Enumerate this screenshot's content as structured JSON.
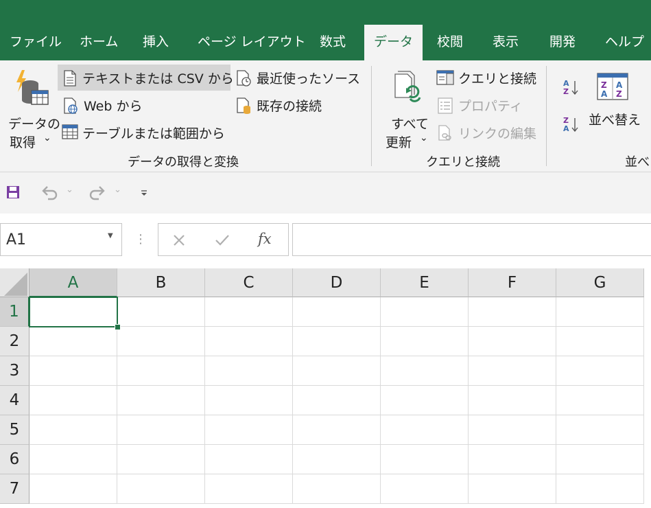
{
  "tabs": [
    {
      "label": "ファイル",
      "active": false
    },
    {
      "label": "ホーム",
      "active": false
    },
    {
      "label": "挿入",
      "active": false
    },
    {
      "label": "ページ レイアウト",
      "active": false
    },
    {
      "label": "数式",
      "active": false
    },
    {
      "label": "データ",
      "active": true
    },
    {
      "label": "校閲",
      "active": false
    },
    {
      "label": "表示",
      "active": false
    },
    {
      "label": "開発",
      "active": false
    },
    {
      "label": "ヘルプ",
      "active": false
    }
  ],
  "ribbon": {
    "get_data": {
      "button_line1": "データの",
      "button_line2": "取得",
      "from_text_csv": "テキストまたは CSV から",
      "from_web": "Web から",
      "from_table": "テーブルまたは範囲から",
      "recent_sources": "最近使ったソース",
      "existing_connections": "既存の接続",
      "group_label": "データの取得と変換"
    },
    "queries": {
      "refresh_line1": "すべて",
      "refresh_line2": "更新",
      "queries_connections": "クエリと接続",
      "properties": "プロパティ",
      "edit_links": "リンクの編集",
      "group_label": "クエリと接続"
    },
    "sort": {
      "sort_label": "並べ替え",
      "group_label": "並べ"
    }
  },
  "formula_bar": {
    "name_box": "A1",
    "fx_label": "fx",
    "formula": ""
  },
  "grid": {
    "columns": [
      "A",
      "B",
      "C",
      "D",
      "E",
      "F",
      "G"
    ],
    "rows": [
      "1",
      "2",
      "3",
      "4",
      "5",
      "6",
      "7"
    ],
    "selected_cell": "A1"
  },
  "colors": {
    "accent": "#217346",
    "ribbon_bg": "#f3f3f3"
  }
}
